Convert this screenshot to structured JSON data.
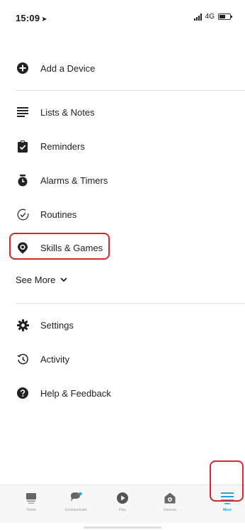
{
  "status_bar": {
    "time": "15:09",
    "location_arrow": "➤",
    "network": "4G"
  },
  "menu": {
    "add_device": {
      "label": "Add a Device",
      "icon": "plus-circle-icon"
    },
    "items": [
      {
        "label": "Lists & Notes",
        "icon": "list-icon"
      },
      {
        "label": "Reminders",
        "icon": "clipboard-check-icon"
      },
      {
        "label": "Alarms & Timers",
        "icon": "alarm-clock-icon"
      },
      {
        "label": "Routines",
        "icon": "routine-check-icon"
      },
      {
        "label": "Skills & Games",
        "icon": "skills-location-icon"
      }
    ],
    "see_more": "See More",
    "secondary_items": [
      {
        "label": "Settings",
        "icon": "gear-icon"
      },
      {
        "label": "Activity",
        "icon": "history-icon"
      },
      {
        "label": "Help & Feedback",
        "icon": "help-icon"
      }
    ]
  },
  "bottom_nav": {
    "items": [
      {
        "label": "Home",
        "icon": "home-icon"
      },
      {
        "label": "Communicate",
        "icon": "chat-bubble-icon"
      },
      {
        "label": "Play",
        "icon": "play-icon"
      },
      {
        "label": "Devices",
        "icon": "devices-icon"
      },
      {
        "label": "More",
        "icon": "menu-icon"
      }
    ],
    "active": "More"
  },
  "colors": {
    "accent": "#1ea2e2",
    "highlight": "#d6262e",
    "icon_dark": "#222222"
  }
}
